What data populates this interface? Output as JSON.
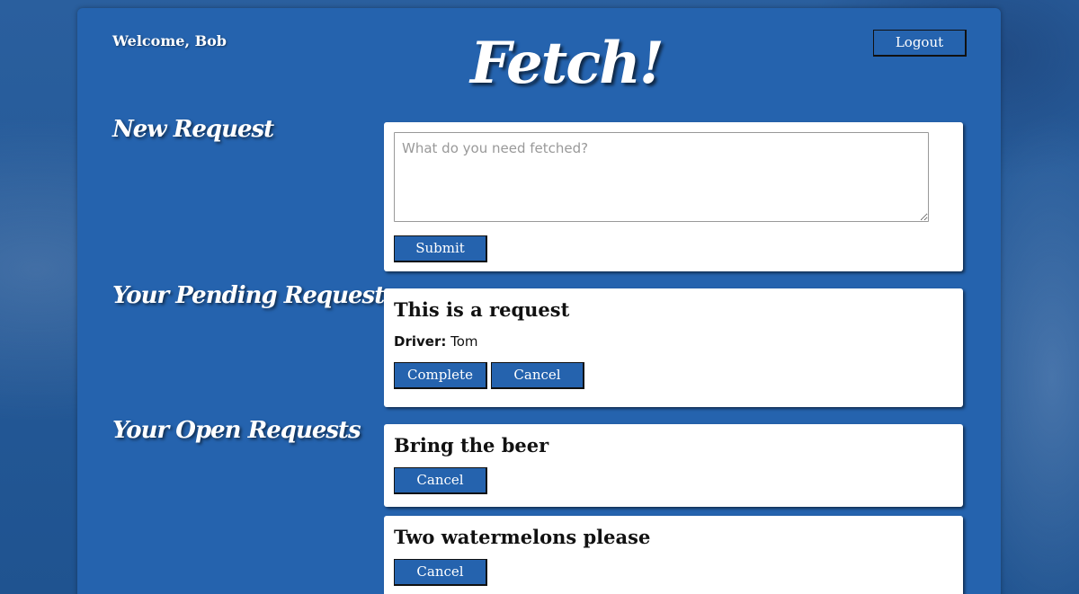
{
  "header": {
    "welcome": "Welcome, Bob",
    "logo": "Fetch!",
    "logout_label": "Logout"
  },
  "new_request": {
    "title": "New Request",
    "placeholder": "What do you need fetched?",
    "submit_label": "Submit"
  },
  "pending": {
    "title": "Your Pending Requests",
    "items": [
      {
        "text": "This is a request",
        "driver_label": "Driver:",
        "driver_name": "Tom",
        "complete_label": "Complete",
        "cancel_label": "Cancel"
      }
    ]
  },
  "open": {
    "title": "Your Open Requests",
    "items": [
      {
        "text": "Bring the beer",
        "cancel_label": "Cancel"
      },
      {
        "text": "Two watermelons please",
        "cancel_label": "Cancel"
      }
    ]
  },
  "colors": {
    "primary": "#2563ae",
    "background": "#255c9c",
    "card": "#ffffff"
  }
}
